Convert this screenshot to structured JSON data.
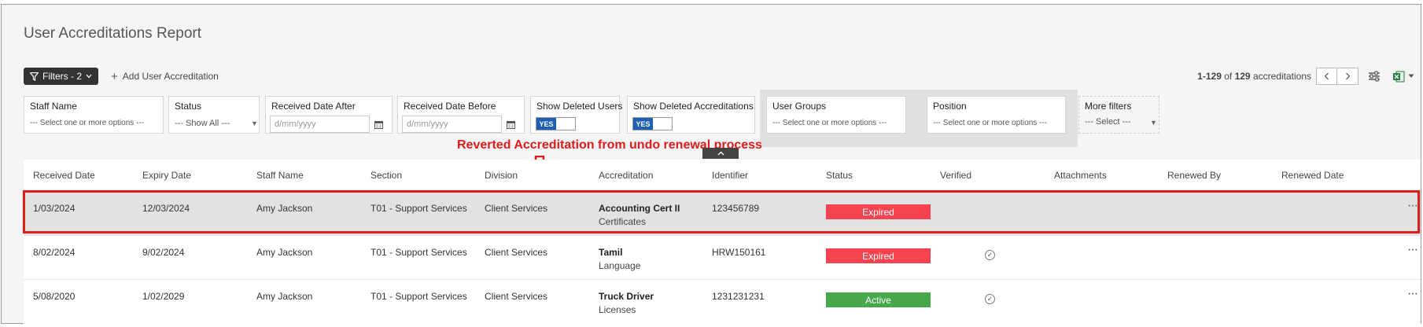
{
  "page": {
    "title": "User Accreditations Report"
  },
  "toolbar": {
    "filters_label": "Filters - 2",
    "add_label": "Add User Accreditation"
  },
  "pagination": {
    "range": "1-129",
    "of": "of",
    "total": "129",
    "unit": "accreditations"
  },
  "filters": {
    "staff_name": {
      "label": "Staff Name",
      "placeholder": "--- Select one or more options ---"
    },
    "status": {
      "label": "Status",
      "value": "--- Show All ---"
    },
    "received_after": {
      "label": "Received Date After",
      "placeholder": "d/mm/yyyy"
    },
    "received_before": {
      "label": "Received Date Before",
      "placeholder": "d/mm/yyyy"
    },
    "show_deleted_users": {
      "label": "Show Deleted Users",
      "toggle": "YES"
    },
    "show_deleted_accreditations": {
      "label": "Show Deleted Accreditations",
      "toggle": "YES"
    },
    "user_groups": {
      "label": "User Groups",
      "placeholder": "--- Select one or more options ---"
    },
    "position": {
      "label": "Position",
      "placeholder": "--- Select one or more options ---"
    },
    "more_filters": {
      "label": "More filters",
      "value": "--- Select ---"
    }
  },
  "annotation": "Reverted Accreditation from undo renewal process",
  "table": {
    "headers": {
      "received": "Received Date",
      "expiry": "Expiry Date",
      "staff": "Staff Name",
      "section": "Section",
      "division": "Division",
      "accreditation": "Accreditation",
      "identifier": "Identifier",
      "status": "Status",
      "verified": "Verified",
      "attachments": "Attachments",
      "renewed_by": "Renewed By",
      "renewed_date": "Renewed Date"
    },
    "rows": [
      {
        "received": "1/03/2024",
        "expiry": "12/03/2024",
        "staff": "Amy Jackson",
        "section": "T01 - Support Services",
        "division": "Client Services",
        "accreditation": "Accounting Cert II",
        "category": "Certificates",
        "identifier": "123456789",
        "status": "Expired"
      },
      {
        "received": "8/02/2024",
        "expiry": "9/02/2024",
        "staff": "Amy Jackson",
        "section": "T01 - Support Services",
        "division": "Client Services",
        "accreditation": "Tamil",
        "category": "Language",
        "identifier": "HRW150161",
        "status": "Expired"
      },
      {
        "received": "5/08/2020",
        "expiry": "1/02/2029",
        "staff": "Amy Jackson",
        "section": "T01 - Support Services",
        "division": "Client Services",
        "accreditation": "Truck Driver",
        "category": "Licenses",
        "identifier": "1231231231",
        "status": "Active"
      }
    ]
  },
  "colors": {
    "expired": "#f5444f",
    "active": "#46a84a",
    "annotation": "#e01b1b",
    "toggle": "#1e5fb4"
  }
}
